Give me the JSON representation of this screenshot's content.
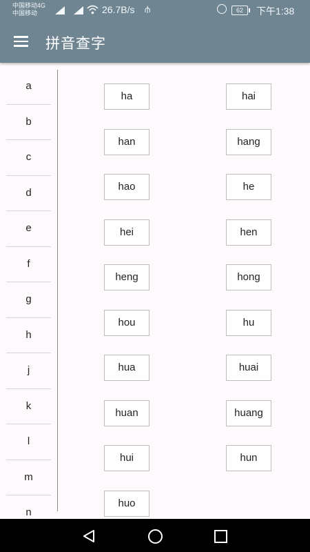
{
  "status": {
    "carrier1": "中国移动4G",
    "carrier2": "中国移动",
    "net_speed": "26.7B/s",
    "battery": "62",
    "time": "下午1:38"
  },
  "appbar": {
    "title": "拼音查字"
  },
  "sidebar": {
    "letters": [
      "a",
      "b",
      "c",
      "d",
      "e",
      "f",
      "g",
      "h",
      "j",
      "k",
      "l",
      "m",
      "n"
    ]
  },
  "syllables": [
    "ha",
    "hai",
    "han",
    "hang",
    "hao",
    "he",
    "hei",
    "hen",
    "heng",
    "hong",
    "hou",
    "hu",
    "hua",
    "huai",
    "huan",
    "huang",
    "hui",
    "hun",
    "huo"
  ],
  "icons": {
    "menu": "hamburger-menu-icon",
    "back": "triangle-back-icon",
    "home": "circle-home-icon",
    "recent": "square-recent-icon"
  }
}
